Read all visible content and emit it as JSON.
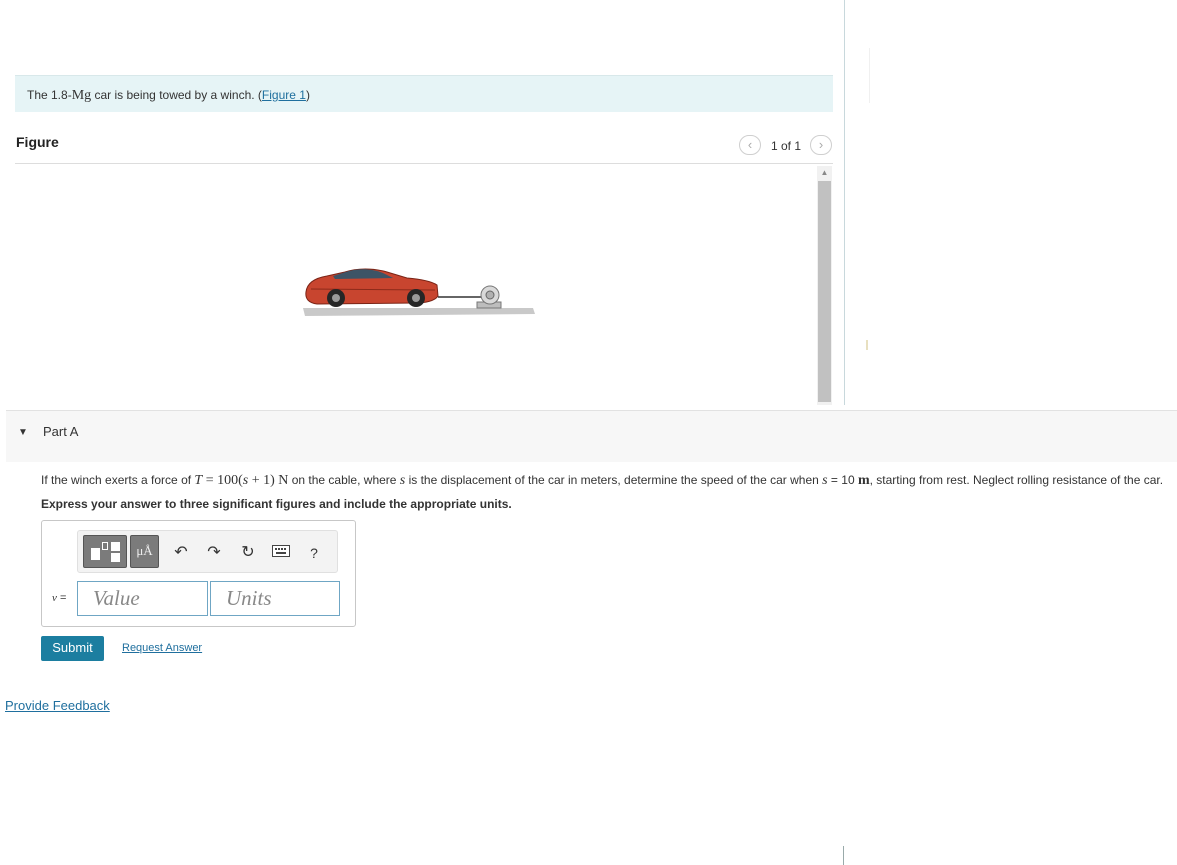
{
  "problem": {
    "intro_before": "The 1.8-",
    "intro_unit": "Mg",
    "intro_after": " car is being towed by a winch. (",
    "figure_link": "Figure 1",
    "intro_close": ")"
  },
  "figure": {
    "heading": "Figure",
    "counter": "1 of 1",
    "prev_icon": "chevron-left",
    "next_icon": "chevron-right"
  },
  "part": {
    "title": "Part A",
    "q_text1": "If the winch exerts a force of ",
    "q_formula_T": "T",
    "q_formula_mid": " = 100(",
    "q_formula_s": "s",
    "q_formula_end": " + 1) N",
    "q_text2": " on the cable, where ",
    "q_var_s": "s",
    "q_text3": " is the displacement of the car in meters, determine the speed of the car when ",
    "q_var_s2": "s",
    "q_text4": " = 10 ",
    "q_unit_m": "m",
    "q_text5": ", starting from rest. Neglect rolling resistance of the car.",
    "instruction": "Express your answer to three significant figures and include the appropriate units."
  },
  "answer": {
    "var_label": "v",
    "equals": " =",
    "value_placeholder": "Value",
    "units_placeholder": "Units",
    "mu_label": "μÅ",
    "help_label": "?"
  },
  "actions": {
    "submit": "Submit",
    "request_answer": "Request Answer",
    "feedback": "Provide Feedback"
  },
  "colors": {
    "accent": "#1c7ea0",
    "link": "#1f6f9e",
    "intro_bg": "#e6f4f6",
    "car_body": "#c8452f"
  }
}
